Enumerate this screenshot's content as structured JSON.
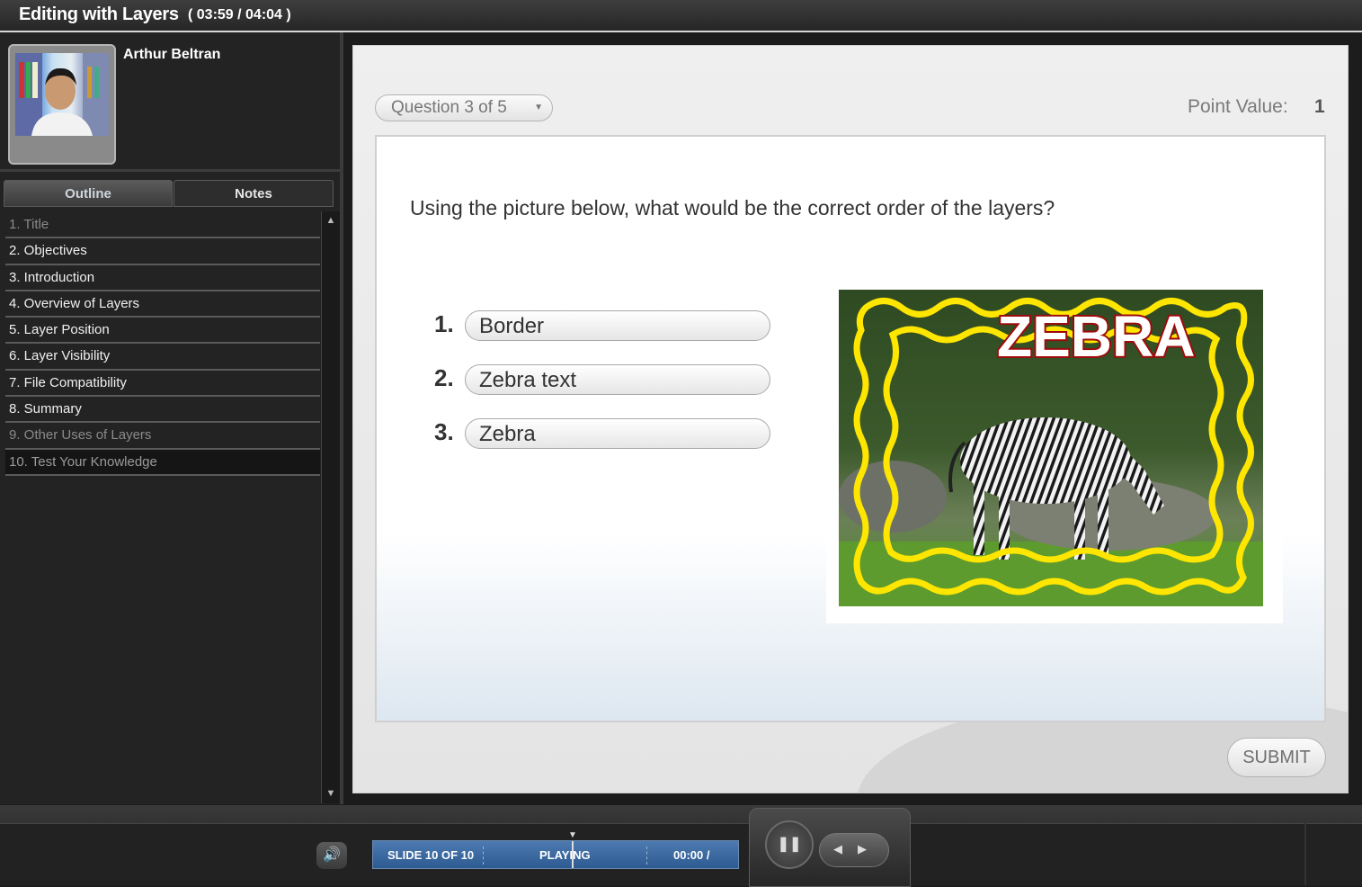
{
  "header": {
    "course_title": "Editing with Layers",
    "time": "( 03:59 / 04:04 )"
  },
  "sidebar": {
    "presenter_name": "Arthur Beltran",
    "tabs": [
      {
        "label": "Outline",
        "active": true
      },
      {
        "label": "Notes",
        "active": false
      }
    ],
    "outline": [
      {
        "label": "1. Title",
        "state": "dim"
      },
      {
        "label": "2. Objectives",
        "state": "normal"
      },
      {
        "label": "3. Introduction",
        "state": "normal"
      },
      {
        "label": "4. Overview of Layers",
        "state": "normal"
      },
      {
        "label": "5. Layer Position",
        "state": "normal"
      },
      {
        "label": "6. Layer Visibility",
        "state": "normal"
      },
      {
        "label": "7. File Compatibility",
        "state": "normal"
      },
      {
        "label": "8. Summary",
        "state": "normal"
      },
      {
        "label": "9. Other Uses of Layers",
        "state": "dim"
      },
      {
        "label": "10. Test Your Knowledge",
        "state": "current"
      }
    ]
  },
  "quiz": {
    "question_selector": "Question 3 of 5",
    "point_label": "Point Value:",
    "point_value": "1",
    "question": "Using the picture below, what would be the correct order of the layers?",
    "answers": [
      {
        "number": "1.",
        "text": "Border"
      },
      {
        "number": "2.",
        "text": "Zebra text"
      },
      {
        "number": "3.",
        "text": "Zebra"
      }
    ],
    "picture_text": "ZEBRA",
    "submit_label": "SUBMIT"
  },
  "controls": {
    "slide_counter": "SLIDE 10 OF 10",
    "play_status": "PLAYING",
    "elapsed": "00:00 /",
    "pause_icon": "pause-icon",
    "volume_icon": "speaker-icon"
  },
  "colors": {
    "progress_blue": "#3a6aa3",
    "frame_yellow": "#ffea00",
    "zebra_text_red": "#9e0b0b"
  }
}
